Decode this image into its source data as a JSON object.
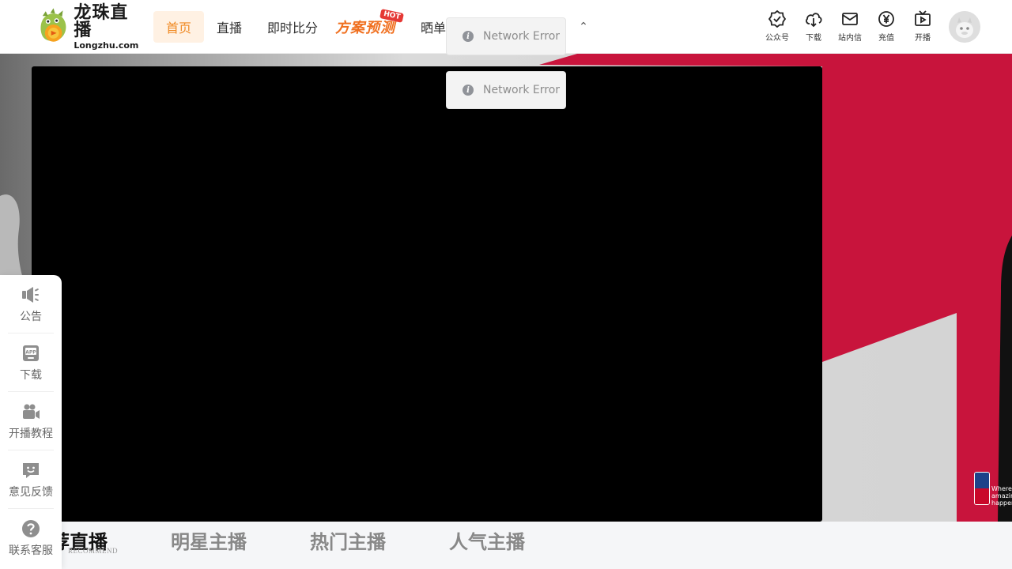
{
  "header": {
    "logo_cn": "龙珠直播",
    "logo_en": "Longzhu.com",
    "nav": [
      {
        "label": "首页",
        "active": true
      },
      {
        "label": "直播"
      },
      {
        "label": "即时比分"
      }
    ],
    "promo": {
      "label": "方案预测",
      "badge": "HOT"
    },
    "nav_after": [
      {
        "label": "晒单"
      }
    ],
    "more_icon": "chevron-down-icon",
    "tools": [
      {
        "label": "公众号",
        "icon": "badge-check-icon"
      },
      {
        "label": "下载",
        "icon": "cloud-download-icon"
      },
      {
        "label": "站内信",
        "icon": "mail-icon"
      },
      {
        "label": "充值",
        "icon": "yen-coin-icon"
      },
      {
        "label": "开播",
        "icon": "tv-play-icon"
      }
    ]
  },
  "toasts": [
    {
      "text": "Network Error"
    },
    {
      "text": "Network Error"
    }
  ],
  "side": [
    {
      "label": "公告",
      "icon": "megaphone-icon"
    },
    {
      "label": "下载",
      "icon": "app-phone-icon"
    },
    {
      "label": "开播教程",
      "icon": "video-camera-icon"
    },
    {
      "label": "意见反馈",
      "icon": "feedback-chat-icon"
    },
    {
      "label": "联系客服",
      "icon": "help-circle-icon"
    }
  ],
  "banner": {
    "nba_tagline": [
      "Where",
      "amazing",
      "happens"
    ],
    "colors": {
      "accent_red": "#c8143c",
      "player_bg": "#000000"
    }
  },
  "tabs": [
    {
      "label": "推荐直播",
      "active": true,
      "sub": "RECOMMEND"
    },
    {
      "label": "明星主播"
    },
    {
      "label": "热门主播"
    },
    {
      "label": "人气主播"
    }
  ],
  "colors": {
    "nav_active_bg": "#fff1e3",
    "nav_active_text": "#f08a24"
  }
}
